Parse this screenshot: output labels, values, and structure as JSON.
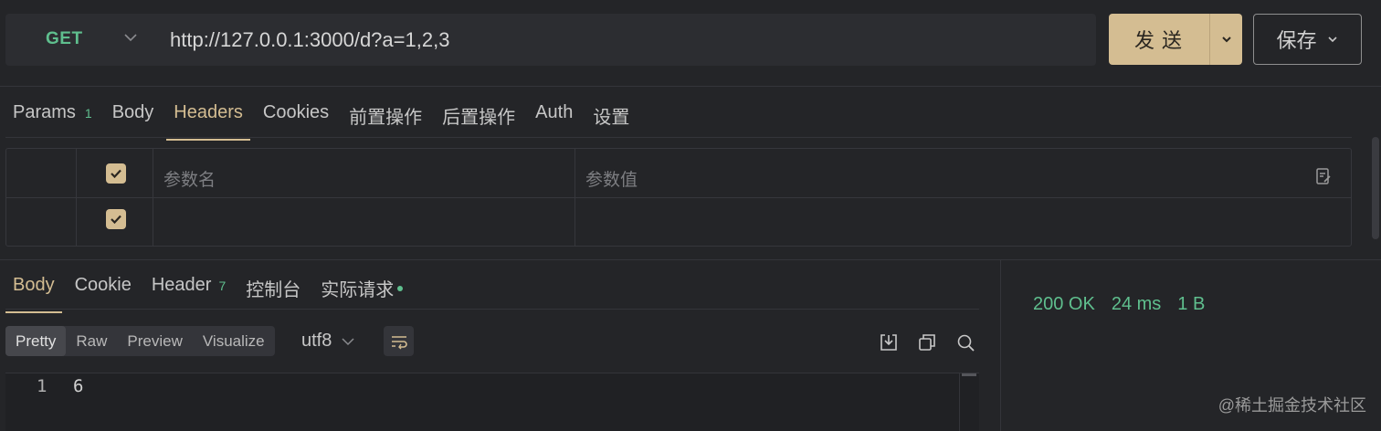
{
  "request": {
    "method": "GET",
    "url": "http://127.0.0.1:3000/d?a=1,2,3",
    "send_label": "发送",
    "save_label": "保存"
  },
  "request_tabs": [
    {
      "label": "Params",
      "badge": "1"
    },
    {
      "label": "Body"
    },
    {
      "label": "Headers",
      "active": true
    },
    {
      "label": "Cookies"
    },
    {
      "label": "前置操作"
    },
    {
      "label": "后置操作"
    },
    {
      "label": "Auth"
    },
    {
      "label": "设置"
    }
  ],
  "headers_table": {
    "name_placeholder": "参数名",
    "value_placeholder": "参数值"
  },
  "response_tabs": [
    {
      "label": "Body",
      "active": true
    },
    {
      "label": "Cookie"
    },
    {
      "label": "Header",
      "badge": "7"
    },
    {
      "label": "控制台"
    },
    {
      "label": "实际请求"
    }
  ],
  "format_buttons": [
    "Pretty",
    "Raw",
    "Preview",
    "Visualize"
  ],
  "encoding": "utf8",
  "editor": {
    "line_number": "1",
    "content": "6"
  },
  "status": {
    "code": "200 OK",
    "time": "24 ms",
    "size": "1 B"
  },
  "watermark": "@稀土掘金技术社区",
  "colors": {
    "accent": "#d4bd92",
    "success": "#5fbf8e",
    "background": "#242528"
  }
}
